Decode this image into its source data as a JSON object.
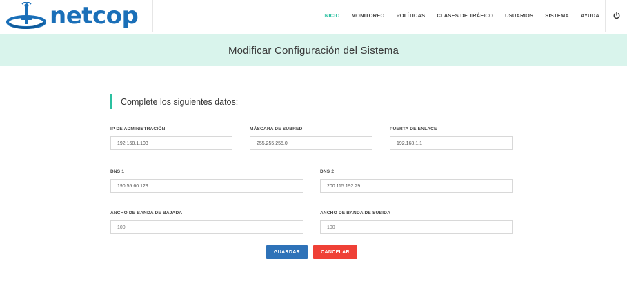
{
  "header": {
    "logo_text": "netcop",
    "nav": [
      {
        "label": "INICIO",
        "active": true
      },
      {
        "label": "MONITOREO"
      },
      {
        "label": "POLÍTICAS"
      },
      {
        "label": "CLASES DE TRÁFICO"
      },
      {
        "label": "USUARIOS"
      },
      {
        "label": "SISTEMA"
      },
      {
        "label": "AYUDA"
      }
    ],
    "power_icon": "power-icon"
  },
  "banner": {
    "title": "Modificar Configuración del Sistema"
  },
  "form": {
    "section_title": "Complete los siguientes datos:",
    "ip_admin": {
      "label": "IP DE ADMINISTRACIÓN",
      "value": "192.168.1.103"
    },
    "subnet_mask": {
      "label": "MÁSCARA DE SUBRED",
      "value": "255.255.255.0"
    },
    "gateway": {
      "label": "PUERTA DE ENLACE",
      "value": "192.168.1.1"
    },
    "dns1": {
      "label": "DNS 1",
      "value": "190.55.60.129"
    },
    "dns2": {
      "label": "DNS 2",
      "value": "200.115.192.29"
    },
    "download_bw": {
      "label": "ANCHO DE BANDA DE BAJADA",
      "placeholder": "100"
    },
    "upload_bw": {
      "label": "ANCHO DE BANDA DE SUBIDA",
      "placeholder": "100"
    }
  },
  "buttons": {
    "save": "GUARDAR",
    "cancel": "CANCELAR"
  },
  "colors": {
    "accent": "#2bc0a0",
    "primary": "#2e72b8",
    "danger": "#ef4036",
    "banner_bg": "#d9f4ec",
    "logo": "#1a6fb8"
  }
}
